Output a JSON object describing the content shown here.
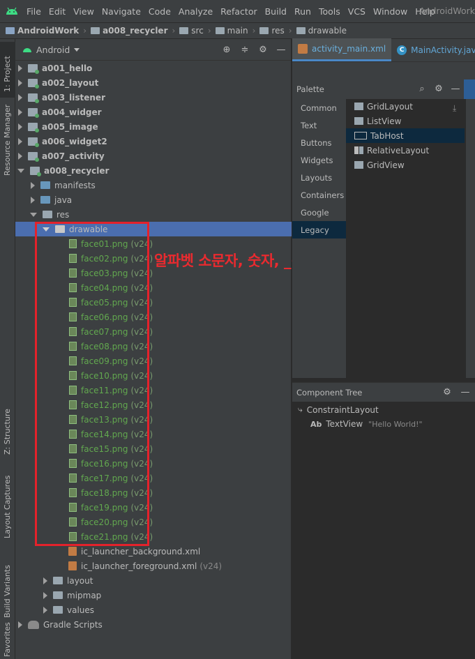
{
  "menubar": {
    "items": [
      "File",
      "Edit",
      "View",
      "Navigate",
      "Code",
      "Analyze",
      "Refactor",
      "Build",
      "Run",
      "Tools",
      "VCS",
      "Window",
      "Help"
    ],
    "project_title": "AndroidWork"
  },
  "breadcrumbs": [
    "AndroidWork",
    "a008_recycler",
    "src",
    "main",
    "res",
    "drawable"
  ],
  "toolstrip": {
    "project_tab": "1: Project",
    "resource_manager_tab": "Resource Manager",
    "structure_tab": "Z: Structure",
    "layout_captures_tab": "Layout Captures",
    "build_variants_tab": "Build Variants",
    "favorites_tab": "Favorites"
  },
  "project_panel": {
    "view_mode": "Android",
    "modules": [
      "a001_hello",
      "a002_layout",
      "a003_listener",
      "a004_widger",
      "a005_image",
      "a006_widget2",
      "a007_activity",
      "a008_recycler"
    ],
    "folders": {
      "manifests": "manifests",
      "java": "java",
      "res": "res",
      "drawable": "drawable",
      "layout": "layout",
      "mipmap": "mipmap",
      "values": "values"
    },
    "drawable_files": [
      "face01.png",
      "face02.png",
      "face03.png",
      "face04.png",
      "face05.png",
      "face06.png",
      "face07.png",
      "face08.png",
      "face09.png",
      "face10.png",
      "face11.png",
      "face12.png",
      "face13.png",
      "face14.png",
      "face15.png",
      "face16.png",
      "face17.png",
      "face18.png",
      "face19.png",
      "face20.png",
      "face21.png"
    ],
    "version_tag": "(v24)",
    "xml_files": [
      {
        "name": "ic_launcher_background.xml",
        "tag": ""
      },
      {
        "name": "ic_launcher_foreground.xml",
        "tag": "(v24)"
      }
    ],
    "gradle_scripts": "Gradle Scripts"
  },
  "annotation": {
    "text": "알파벳 소문자, 숫자, _(언더바)만 가능",
    "color": "#e4222b"
  },
  "editor": {
    "tabs": [
      {
        "label": "activity_main.xml",
        "active": true
      },
      {
        "label": "MainActivity.java",
        "active": false
      }
    ]
  },
  "palette": {
    "title": "Palette",
    "categories": [
      "Common",
      "Text",
      "Buttons",
      "Widgets",
      "Layouts",
      "Containers",
      "Google",
      "Legacy"
    ],
    "selected_category": "Legacy",
    "items": [
      "GridLayout",
      "ListView",
      "TabHost",
      "RelativeLayout",
      "GridView"
    ],
    "selected_item": "TabHost"
  },
  "component_tree": {
    "title": "Component Tree",
    "root": "ConstraintLayout",
    "child_label": "TextView",
    "child_icon_text": "Ab",
    "child_hint": "\"Hello World!\""
  },
  "colors": {
    "ide_background": "#2b2b2b",
    "panel": "#3c3f41",
    "selection": "#4b6eaf",
    "png_text": "#62a84f",
    "annotation_red": "#e4222b"
  }
}
